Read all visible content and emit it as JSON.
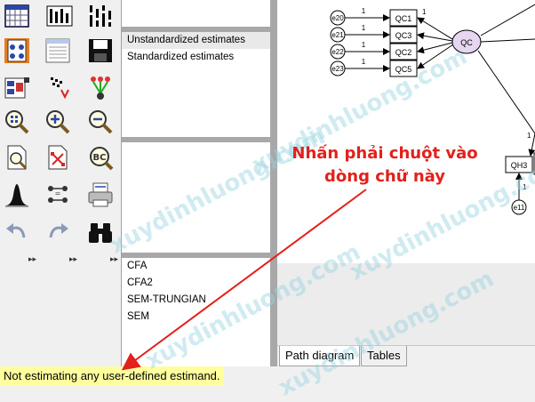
{
  "analysis_list": {
    "items": [
      "Unstandardized estimates",
      "Standardized estimates"
    ],
    "selected_index": 0
  },
  "models_list": {
    "items": [
      "CFA",
      "CFA2",
      "SEM-TRUNGIAN",
      "SEM"
    ]
  },
  "tabs": {
    "path_diagram": "Path diagram",
    "tables": "Tables",
    "active": "path_diagram"
  },
  "status_bar": {
    "message": "Not estimating any user-defined estimand.",
    "highlight_color": "#ffff9e"
  },
  "annotation": {
    "line1": "Nhấn phải chuột vào",
    "line2": "dòng chữ này",
    "color": "#e3201b"
  },
  "watermark": {
    "text": "xuydinhluong.com"
  },
  "diagram": {
    "latent": "QC",
    "observed": [
      "QC1",
      "QC3",
      "QC2",
      "QC5",
      "QH3"
    ],
    "errors": [
      "e20",
      "e21",
      "e22",
      "e23",
      "e11"
    ],
    "path_label": "1"
  },
  "toolbox_icons": [
    "draw-observed-icon",
    "draw-latent-icon",
    "draw-indicator-icon",
    "draw-path-icon",
    "draw-covariance-icon",
    "add-error-icon",
    "list-variables-icon",
    "list-dataset-icon",
    "save-icon",
    "select-one-icon",
    "select-all-icon",
    "deselect-icon",
    "copy-icon",
    "move-icon",
    "erase-icon",
    "zoom-select-icon",
    "zoom-in-icon",
    "zoom-out-icon",
    "page-icon",
    "resize-icon",
    "loupe-icon",
    "distribution-icon",
    "multi-group-icon",
    "print-icon",
    "undo-icon",
    "redo-icon",
    "binoculars-icon"
  ]
}
